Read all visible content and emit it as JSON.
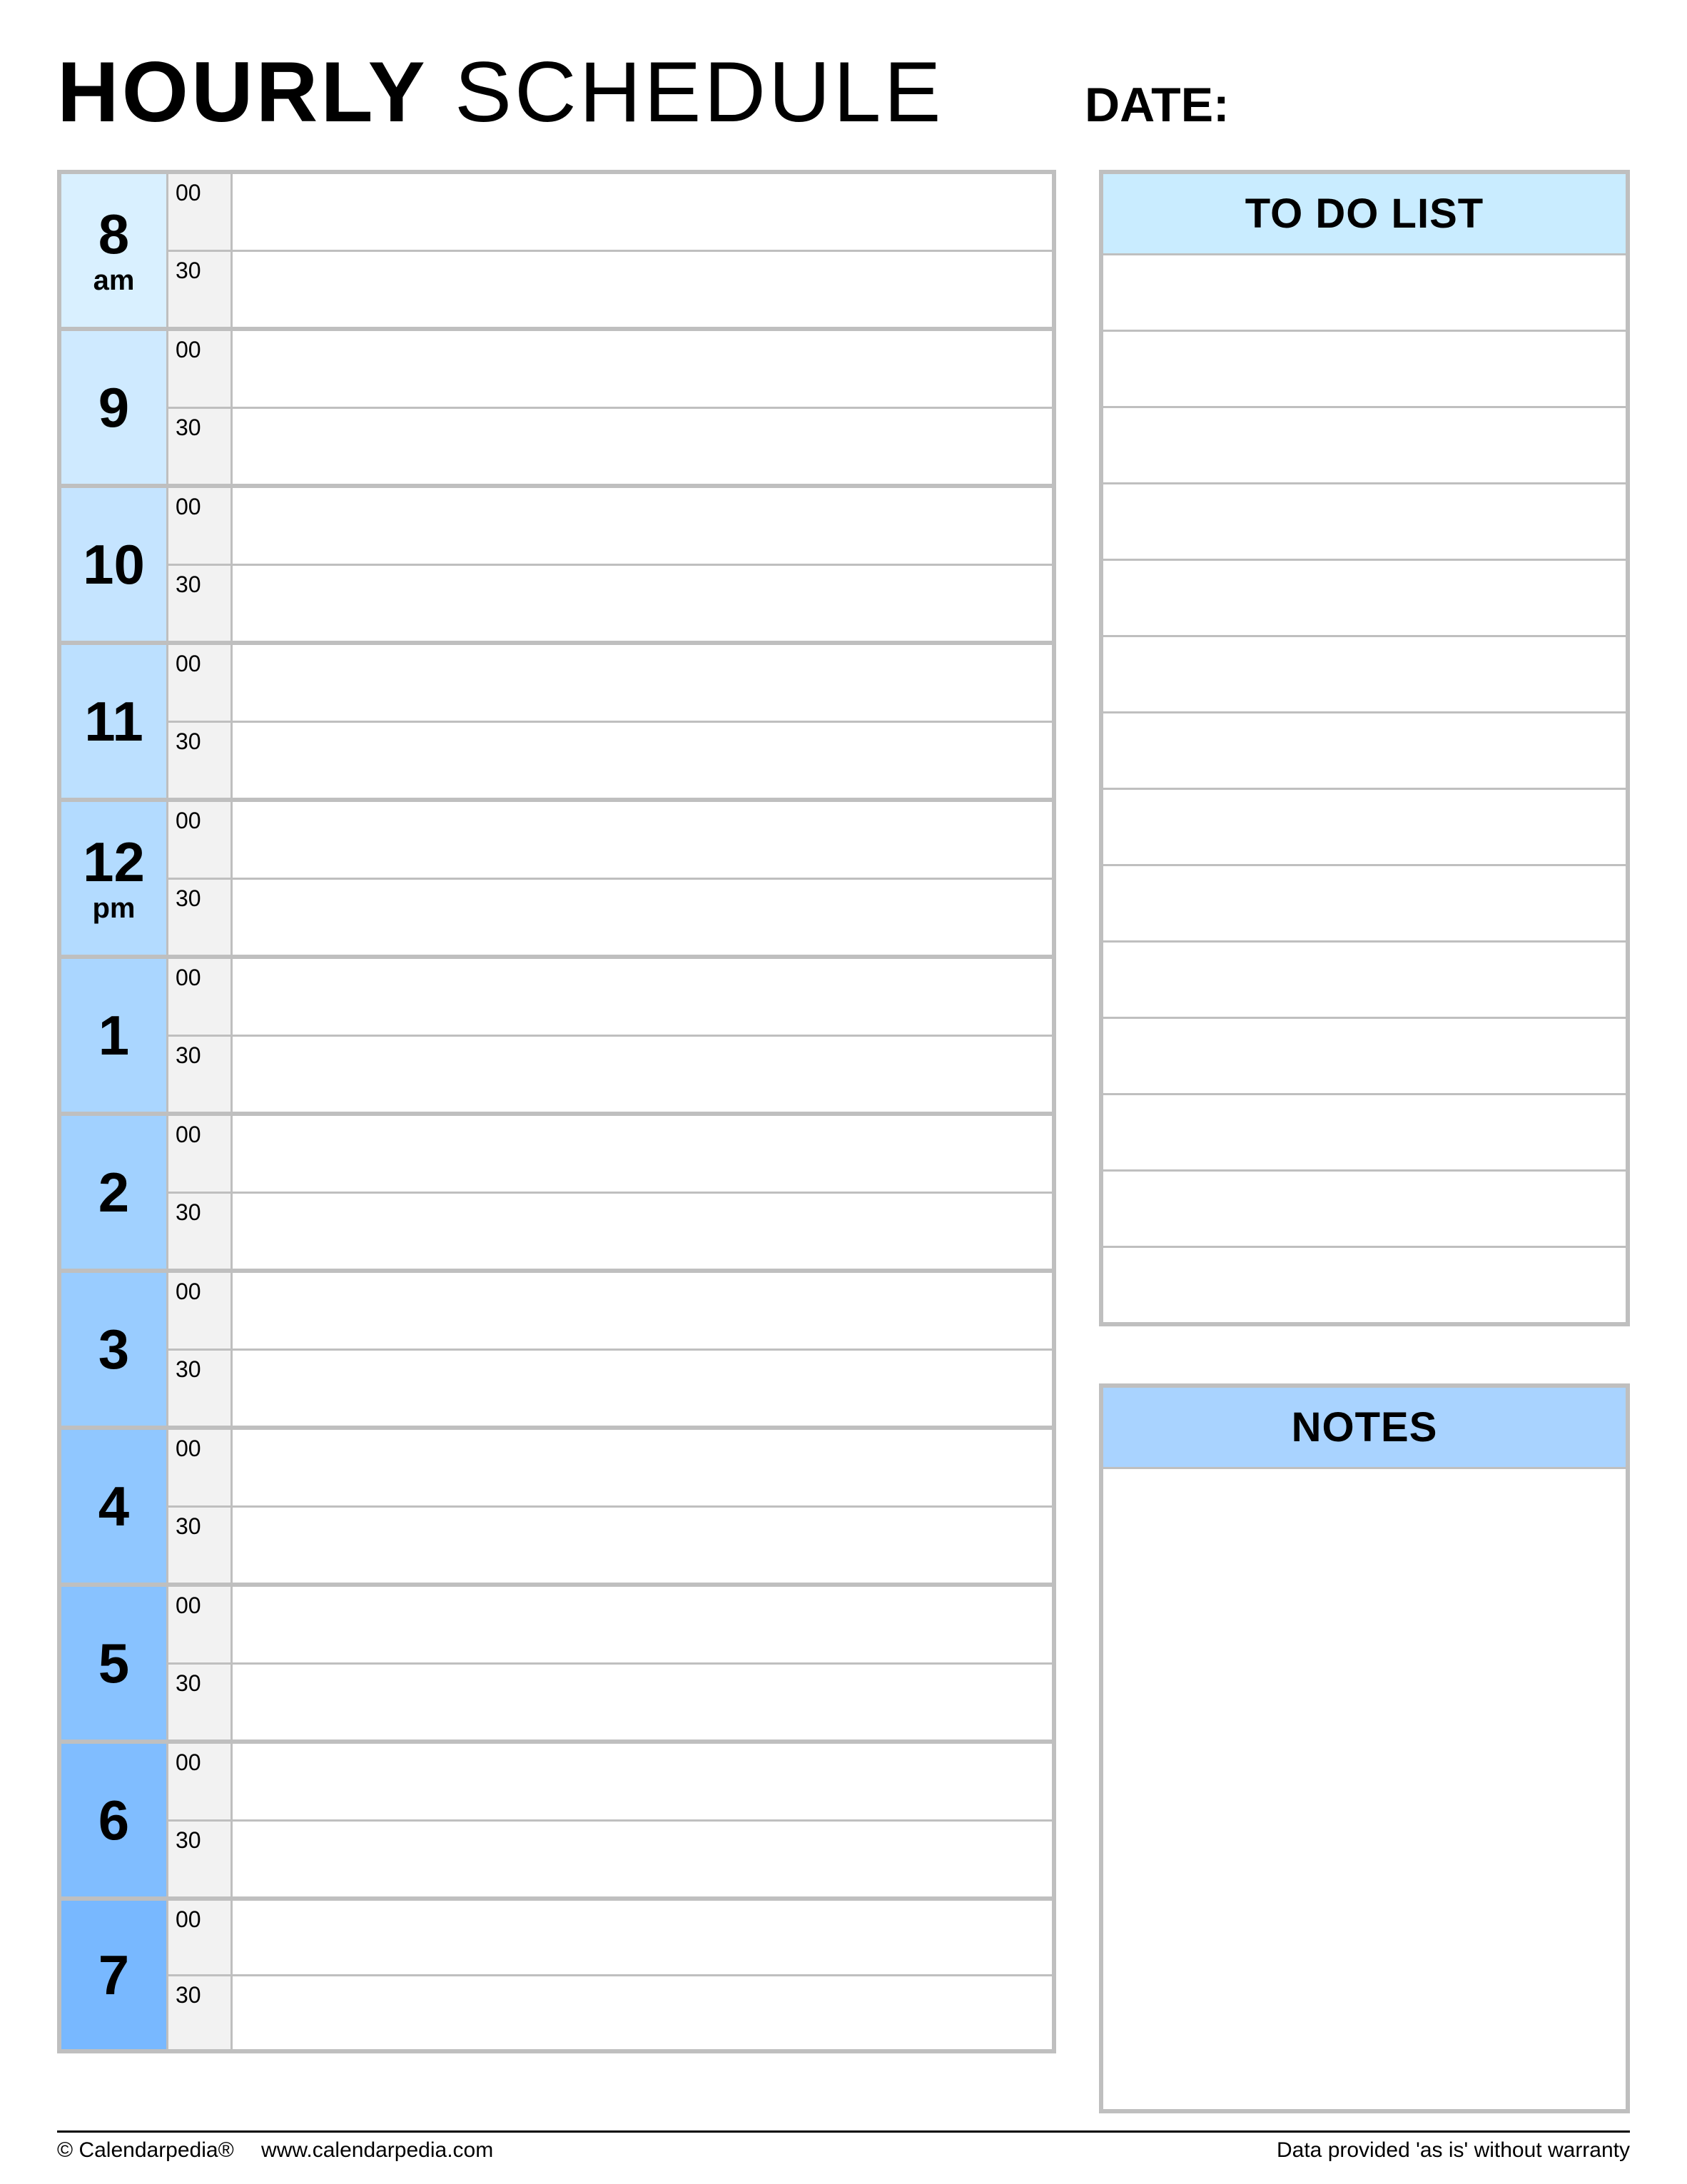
{
  "title_bold": "HOURLY",
  "title_light": " SCHEDULE",
  "date_label": "DATE:",
  "date_value": "",
  "hours": [
    {
      "num": "8",
      "ampm": "am",
      "tint": "tint-0"
    },
    {
      "num": "9",
      "ampm": "",
      "tint": "tint-1"
    },
    {
      "num": "10",
      "ampm": "",
      "tint": "tint-2"
    },
    {
      "num": "11",
      "ampm": "",
      "tint": "tint-3"
    },
    {
      "num": "12",
      "ampm": "pm",
      "tint": "tint-4"
    },
    {
      "num": "1",
      "ampm": "",
      "tint": "tint-5"
    },
    {
      "num": "2",
      "ampm": "",
      "tint": "tint-6"
    },
    {
      "num": "3",
      "ampm": "",
      "tint": "tint-7"
    },
    {
      "num": "4",
      "ampm": "",
      "tint": "tint-8"
    },
    {
      "num": "5",
      "ampm": "",
      "tint": "tint-9"
    },
    {
      "num": "6",
      "ampm": "",
      "tint": "tint-10"
    },
    {
      "num": "7",
      "ampm": "",
      "tint": "tint-11"
    }
  ],
  "minute_labels": [
    "00",
    "30"
  ],
  "todo_header": "TO DO LIST",
  "todo_rows": 14,
  "notes_header": "NOTES",
  "footer": {
    "copyright": "© Calendarpedia®",
    "url": "www.calendarpedia.com",
    "disclaimer": "Data provided 'as is' without warranty"
  }
}
